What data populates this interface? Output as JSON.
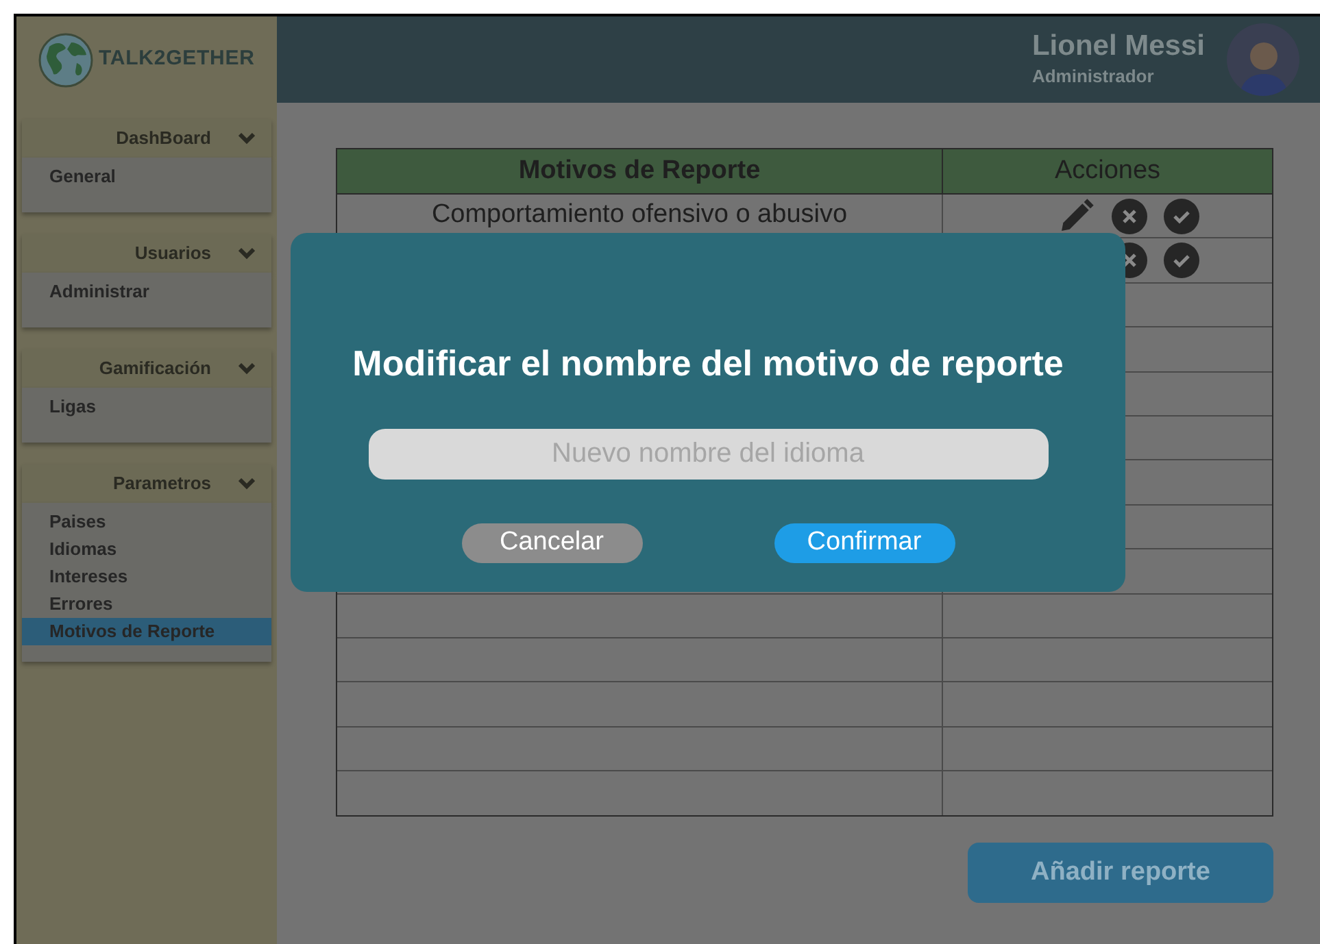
{
  "brand": {
    "name": "TALK2GETHER"
  },
  "user": {
    "name": "Lionel Messi",
    "role": "Administrador"
  },
  "sidebar": {
    "sections": [
      {
        "title": "DashBoard",
        "expanded": true,
        "items": [
          {
            "label": "General",
            "selected": false
          }
        ]
      },
      {
        "title": "Usuarios",
        "expanded": true,
        "items": [
          {
            "label": "Administrar",
            "selected": false
          }
        ]
      },
      {
        "title": "Gamificación",
        "expanded": true,
        "items": [
          {
            "label": "Ligas",
            "selected": false
          }
        ]
      },
      {
        "title": "Parametros",
        "expanded": true,
        "items": [
          {
            "label": "Paises",
            "selected": false
          },
          {
            "label": "Idiomas",
            "selected": false
          },
          {
            "label": "Intereses",
            "selected": false
          },
          {
            "label": "Errores",
            "selected": false
          },
          {
            "label": "Motivos de Reporte",
            "selected": true
          }
        ]
      }
    ]
  },
  "table": {
    "columns": [
      "Motivos de Reporte",
      "Acciones"
    ],
    "rows": [
      {
        "name": "Comportamiento ofensivo o abusivo",
        "actions": [
          {
            "kind": "edit"
          },
          {
            "kind": "reject"
          },
          {
            "kind": "approve"
          }
        ]
      },
      {
        "actions": [
          {
            "kind": "reject"
          },
          {
            "kind": "approve"
          }
        ]
      },
      {},
      {},
      {},
      {},
      {},
      {},
      {},
      {},
      {},
      {},
      {},
      {}
    ]
  },
  "add_button": "Añadir reporte",
  "dialog": {
    "title": "Modificar el nombre del motivo de reporte",
    "placeholder": "Nuevo nombre del idioma",
    "buttons": [
      {
        "label": "Cancelar",
        "kind": "secondary"
      },
      {
        "label": "Confirmar",
        "kind": "primary"
      }
    ]
  }
}
